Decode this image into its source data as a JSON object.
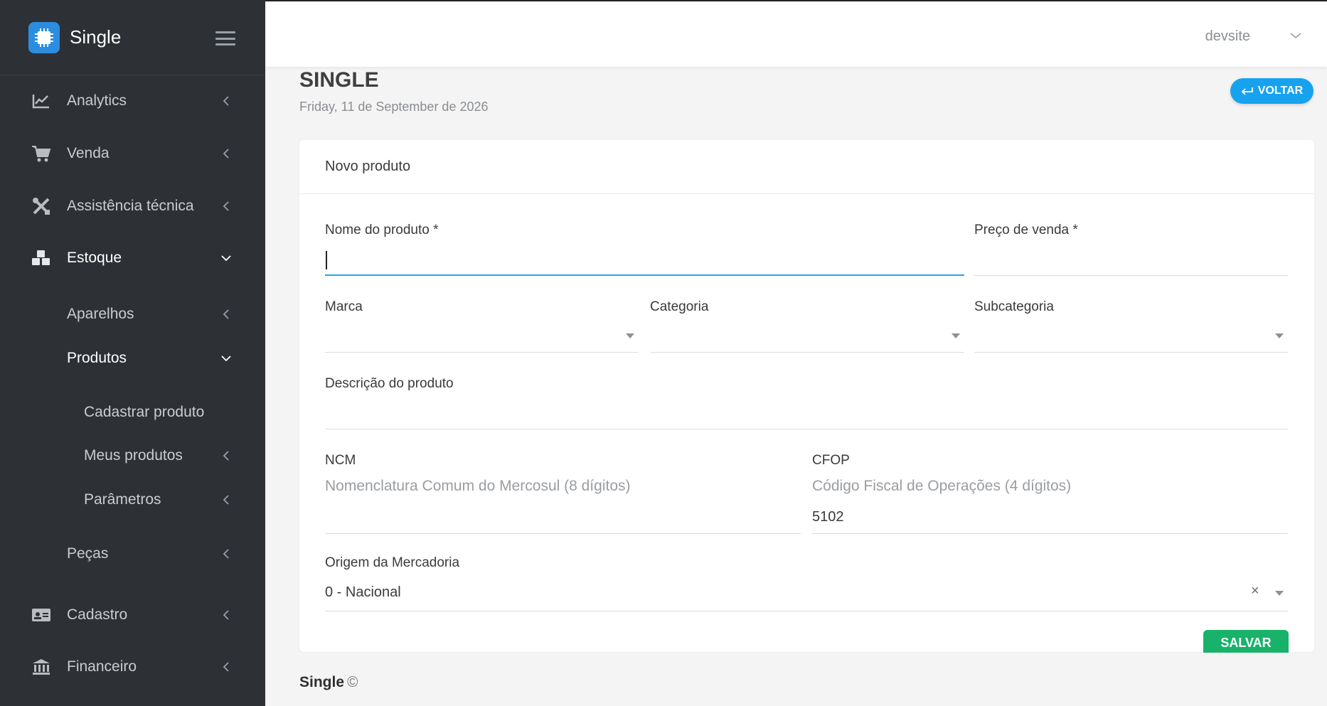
{
  "app": {
    "name": "Single",
    "user": "devsite"
  },
  "sidebar": {
    "items": [
      {
        "label": "Analytics",
        "icon": "chart-icon"
      },
      {
        "label": "Venda",
        "icon": "cart-icon"
      },
      {
        "label": "Assistência técnica",
        "icon": "tools-icon"
      },
      {
        "label": "Estoque",
        "icon": "boxes-icon"
      },
      {
        "label": "Aparelhos"
      },
      {
        "label": "Produtos"
      },
      {
        "label": "Cadastrar produto"
      },
      {
        "label": "Meus produtos"
      },
      {
        "label": "Parâmetros"
      },
      {
        "label": "Peças"
      },
      {
        "label": "Cadastro",
        "icon": "id-card-icon"
      },
      {
        "label": "Financeiro",
        "icon": "bank-icon"
      }
    ]
  },
  "page": {
    "title": "SINGLE",
    "date": "Friday, 11 de September de 2026",
    "back_label": "VOLTAR"
  },
  "form": {
    "card_title": "Novo produto",
    "nome_label": "Nome do produto *",
    "preco_label": "Preço de venda *",
    "marca_label": "Marca",
    "categoria_label": "Categoria",
    "subcategoria_label": "Subcategoria",
    "descricao_label": "Descrição do produto",
    "ncm_label": "NCM",
    "ncm_placeholder": "Nomenclatura Comum do Mercosul (8 dígitos)",
    "cfop_label": "CFOP",
    "cfop_placeholder": "Código Fiscal de Operações (4 dígitos)",
    "cfop_value": "5102",
    "origem_label": "Origem da Mercadoria",
    "origem_value": "0 - Nacional",
    "clear_symbol": "×",
    "save_label": "SALVAR"
  },
  "footer": {
    "brand": "Single",
    "copyright": "©"
  }
}
